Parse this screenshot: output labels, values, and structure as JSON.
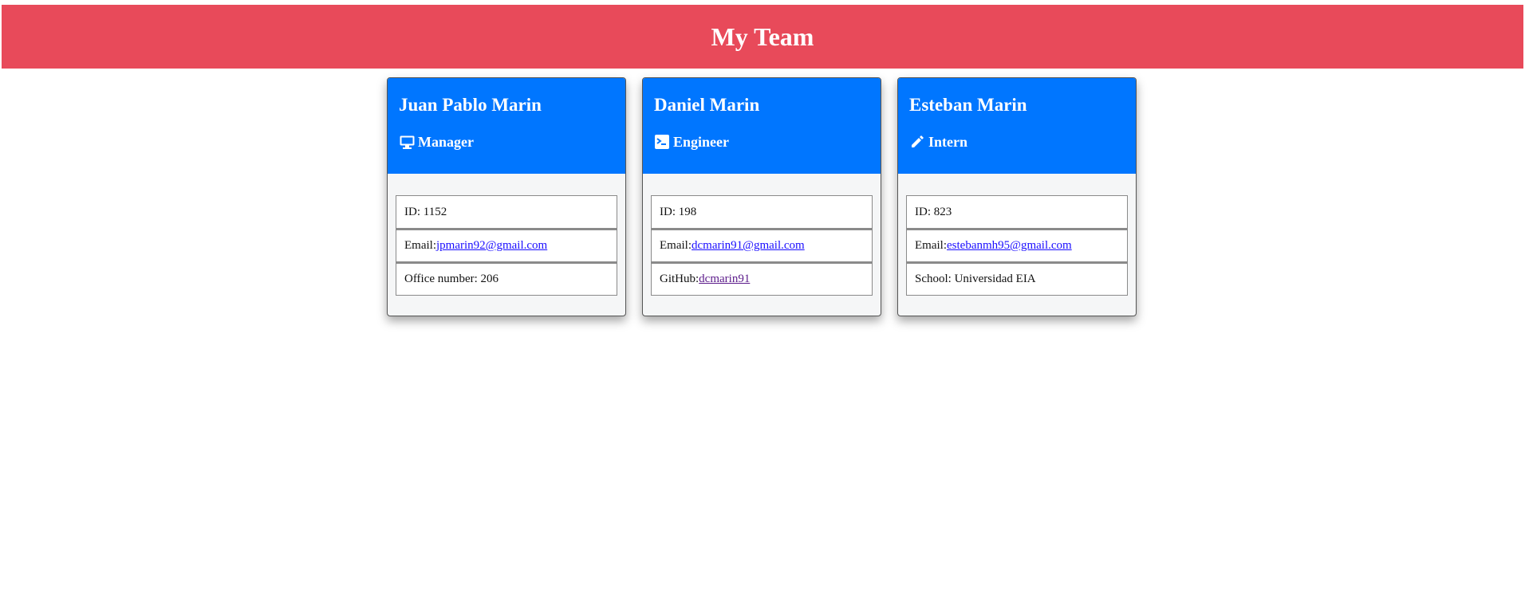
{
  "header": {
    "title": "My Team",
    "background": "#e84a5a"
  },
  "accent": "#0076ff",
  "cards": [
    {
      "name": "Juan Pablo Marin",
      "role": "Manager",
      "role_icon": "monitor-icon",
      "id_label": "ID: 1152",
      "email_prefix": "Email:",
      "email": "jpmarin92@gmail.com",
      "extra_text": "Office number: 206"
    },
    {
      "name": "Daniel Marin",
      "role": "Engineer",
      "role_icon": "terminal-icon",
      "id_label": "ID: 198",
      "email_prefix": "Email:",
      "email": "dcmarin91@gmail.com",
      "extra_prefix": "GitHub:",
      "extra_link": "dcmarin91"
    },
    {
      "name": "Esteban Marin",
      "role": "Intern",
      "role_icon": "pencil-icon",
      "id_label": "ID: 823",
      "email_prefix": "Email:",
      "email": "estebanmh95@gmail.com",
      "extra_text": "School: Universidad EIA"
    }
  ]
}
